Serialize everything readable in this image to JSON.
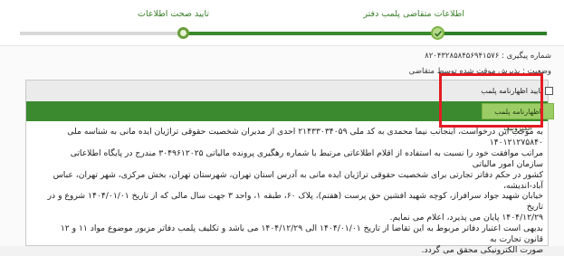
{
  "steps": {
    "step1_label": "اطلاعات متقاضی پلمب دفتر",
    "step2_label": "تایید صحت اطلاعات"
  },
  "info": {
    "tracking": "شماره پیگیری : ۸۲۰۴۳۲۸۵۸۴۵۶۹۴۱۵۷۶",
    "status": "وضعیت : پذیرش موقت شده توسط متقاضی"
  },
  "declaration": {
    "checkbox_label": "تایید اظهارنامه پلمب",
    "button_label": "اظهارنامه پلمب الکترونیک"
  },
  "body_lines": [
    "به موجب این درخواست، اینجانب نیما محمدی به کد ملی ۲۱۴۳۳۰۳۴۰۵۹ احدی از مدیران شخصیت حقوقی تراژیان ایده مانی به شناسه ملی ۱۴۰۱۲۱۲۷۵۸۴۰",
    "مراتب موافقت خود را نسبت به استفاده از اقلام اطلاعاتی مرتبط با شماره رهگیری پرونده مالیاتی ۳۰۴۹۶۱۲۰۲۵ مندرج در پایگاه اطلاعاتی سازمان امور مالیاتی",
    "کشور در حکم دفاتر تجارتی برای شخصیت حقوقی تراژیان ایده مانی به آدرس استان تهران، شهرستان تهران، بخش مرکزی، شهر تهران، عباس آباد-اندیشه،",
    "خیابان شهید جواد سرافراز، کوچه شهید افشین حق پرست (هفتم)، پلاک ۶۰، طبقه ۱، واحد ۳ جهت سال مالی که از تاریخ ۱۴۰۴/۰۱/۰۱ شروع و در تاریخ",
    "۱۴۰۴/۱۲/۲۹ پایان می پذیرد، اعلام می نمایم.",
    "بدیهی است اعتبار دفاتر مربوط به این تقاضا از تاریخ ۱۴۰۴/۰۱/۰۱ الی ۱۴۰۴/۱۲/۲۹ می باشد و تکلیف پلمب دفاتر مزبور موضوع مواد ۱۱ و ۱۲ قانون تجارت به",
    "صورت الکترونیکی محقق می گردد."
  ],
  "colors": {
    "accent_green": "#3b8a2f",
    "button_green": "#9ccc65",
    "highlight_red": "#e41b23"
  }
}
